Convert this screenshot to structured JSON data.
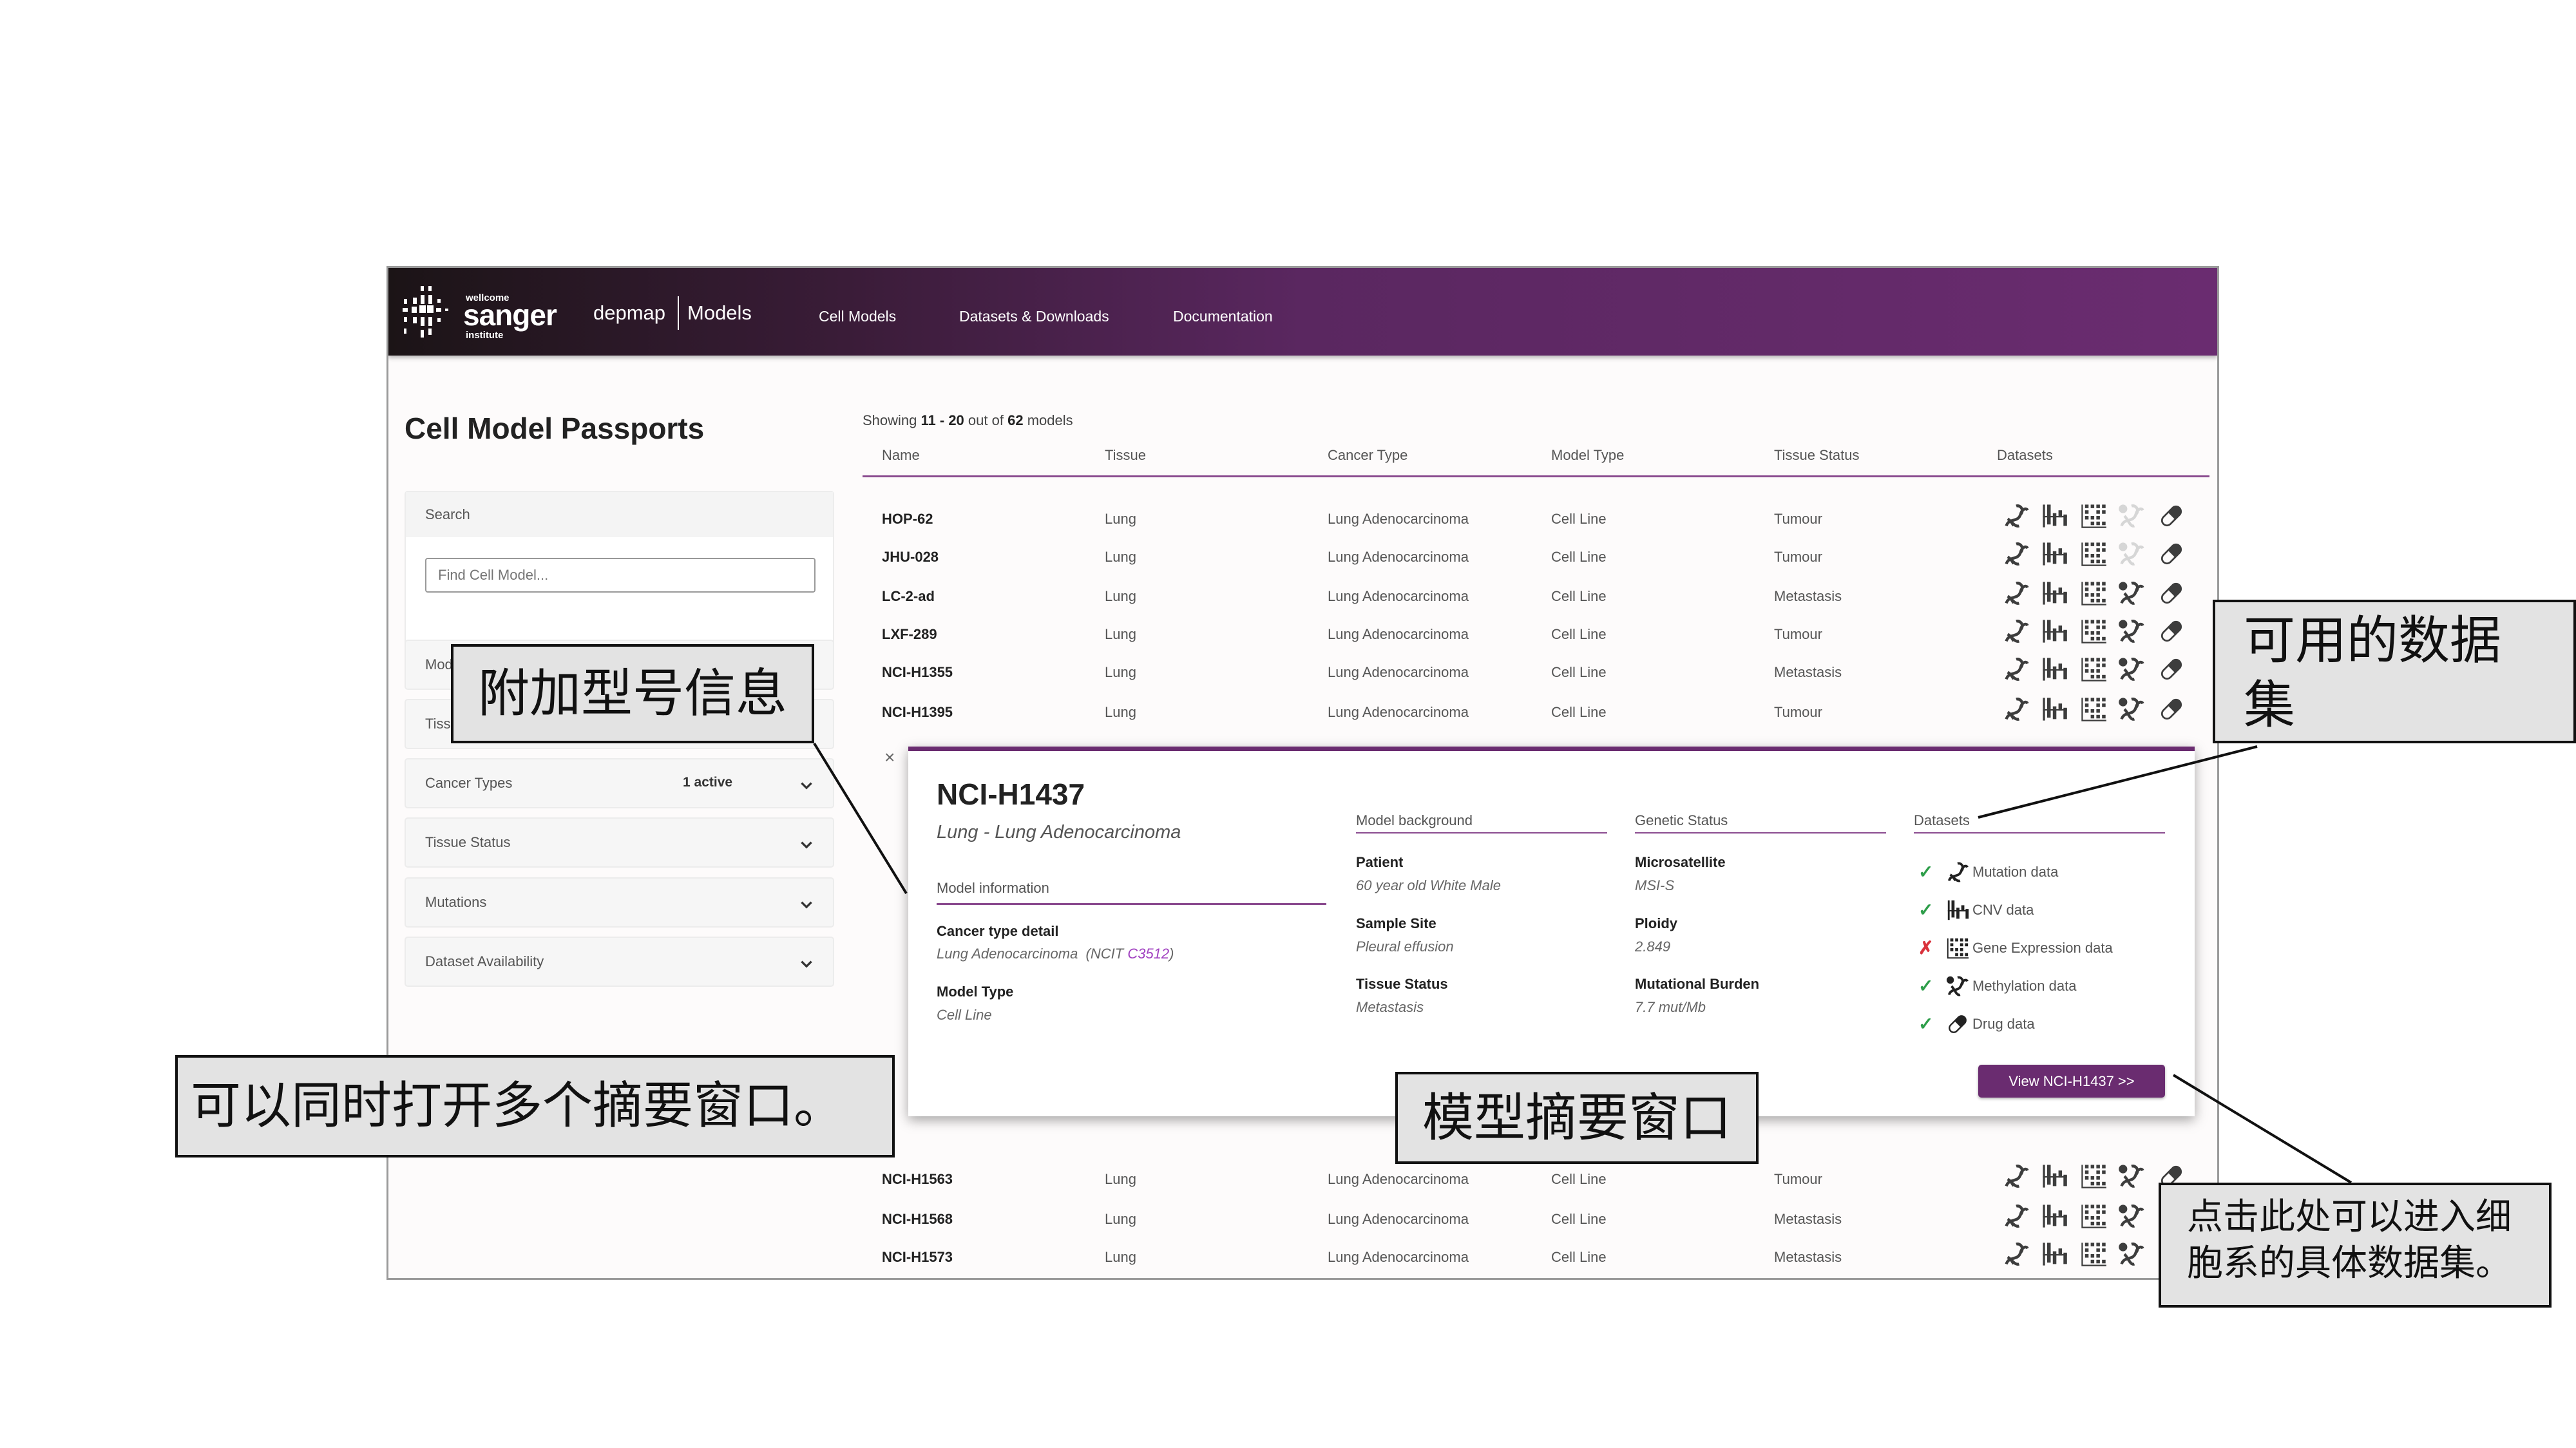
{
  "header": {
    "logo": {
      "top": "wellcome",
      "main": "sanger",
      "bottom": "institute"
    },
    "brand": "depmap",
    "section": "Models",
    "nav": [
      "Cell Models",
      "Datasets & Downloads",
      "Documentation"
    ]
  },
  "page_title": "Cell Model Passports",
  "showing": {
    "prefix": "Showing",
    "range": "11 - 20",
    "mid": "out of",
    "total": "62",
    "suffix": "models"
  },
  "table": {
    "columns": [
      "Name",
      "Tissue",
      "Cancer Type",
      "Model Type",
      "Tissue Status",
      "Datasets"
    ],
    "dataset_icons": [
      "mutation-icon",
      "cnv-icon",
      "gene-expression-icon",
      "methylation-icon",
      "drug-icon"
    ],
    "rows_top": [
      {
        "name": "HOP-62",
        "tissue": "Lung",
        "cancer_type": "Lung Adenocarcinoma",
        "model_type": "Cell Line",
        "tissue_status": "Tumour",
        "datasets": [
          true,
          true,
          true,
          false,
          true
        ]
      },
      {
        "name": "JHU-028",
        "tissue": "Lung",
        "cancer_type": "Lung Adenocarcinoma",
        "model_type": "Cell Line",
        "tissue_status": "Tumour",
        "datasets": [
          true,
          true,
          true,
          false,
          true
        ]
      },
      {
        "name": "LC-2-ad",
        "tissue": "Lung",
        "cancer_type": "Lung Adenocarcinoma",
        "model_type": "Cell Line",
        "tissue_status": "Metastasis",
        "datasets": [
          true,
          true,
          true,
          true,
          true
        ]
      },
      {
        "name": "LXF-289",
        "tissue": "Lung",
        "cancer_type": "Lung Adenocarcinoma",
        "model_type": "Cell Line",
        "tissue_status": "Tumour",
        "datasets": [
          true,
          true,
          true,
          true,
          true
        ]
      },
      {
        "name": "NCI-H1355",
        "tissue": "Lung",
        "cancer_type": "Lung Adenocarcinoma",
        "model_type": "Cell Line",
        "tissue_status": "Metastasis",
        "datasets": [
          true,
          true,
          true,
          true,
          true
        ]
      },
      {
        "name": "NCI-H1395",
        "tissue": "Lung",
        "cancer_type": "Lung Adenocarcinoma",
        "model_type": "Cell Line",
        "tissue_status": "Tumour",
        "datasets": [
          true,
          true,
          true,
          true,
          true
        ]
      }
    ],
    "rows_bottom": [
      {
        "name": "NCI-H1563",
        "tissue": "Lung",
        "cancer_type": "Lung Adenocarcinoma",
        "model_type": "Cell Line",
        "tissue_status": "Tumour",
        "datasets": [
          true,
          true,
          true,
          true,
          true
        ]
      },
      {
        "name": "NCI-H1568",
        "tissue": "Lung",
        "cancer_type": "Lung Adenocarcinoma",
        "model_type": "Cell Line",
        "tissue_status": "Metastasis",
        "datasets": [
          true,
          true,
          true,
          true,
          false
        ]
      },
      {
        "name": "NCI-H1573",
        "tissue": "Lung",
        "cancer_type": "Lung Adenocarcinoma",
        "model_type": "Cell Line",
        "tissue_status": "Metastasis",
        "datasets": [
          true,
          true,
          true,
          true,
          false
        ]
      }
    ]
  },
  "sidebar": {
    "search": {
      "label": "Search",
      "placeholder": "Find Cell Model..."
    },
    "filters": [
      {
        "label": "Model Types",
        "visible_label": "Mod",
        "active": ""
      },
      {
        "label": "Tissues",
        "visible_label": "Tiss",
        "active": ""
      },
      {
        "label": "Cancer Types",
        "visible_label": "Cancer Types",
        "active": "1 active"
      },
      {
        "label": "Tissue Status",
        "visible_label": "Tissue Status",
        "active": ""
      },
      {
        "label": "Mutations",
        "visible_label": "Mutations",
        "active": ""
      },
      {
        "label": "Dataset Availability",
        "visible_label": "Dataset Availability",
        "active": ""
      }
    ]
  },
  "popup": {
    "close": "×",
    "title": "NCI-H1437",
    "subtitle": "Lung - Lung Adenocarcinoma",
    "model_information": {
      "label": "Model information",
      "cancer_type_detail_key": "Cancer type detail",
      "cancer_type_detail_value": "Lung Adenocarcinoma  (NCIT ",
      "ncit_code": "C3512",
      "cancer_type_detail_close": ")",
      "model_type_key": "Model Type",
      "model_type_value": "Cell Line"
    },
    "model_background": {
      "label": "Model background",
      "items": [
        {
          "key": "Patient",
          "value": "60 year old White Male"
        },
        {
          "key": "Sample Site",
          "value": "Pleural effusion"
        },
        {
          "key": "Tissue Status",
          "value": "Metastasis"
        }
      ]
    },
    "genetic_status": {
      "label": "Genetic Status",
      "items": [
        {
          "key": "Microsatellite",
          "value": "MSI-S"
        },
        {
          "key": "Ploidy",
          "value": "2.849"
        },
        {
          "key": "Mutational Burden",
          "value": "7.7 mut/Mb"
        }
      ]
    },
    "datasets": {
      "label": "Datasets",
      "items": [
        {
          "label": "Mutation data",
          "available": true,
          "icon": "mutation-icon"
        },
        {
          "label": "CNV data",
          "available": true,
          "icon": "cnv-icon"
        },
        {
          "label": "Gene Expression data",
          "available": false,
          "icon": "gene-expression-icon"
        },
        {
          "label": "Methylation data",
          "available": true,
          "icon": "methylation-icon"
        },
        {
          "label": "Drug data",
          "available": true,
          "icon": "drug-icon"
        }
      ]
    },
    "view_button": "View NCI-H1437 >>"
  },
  "annotations": {
    "additional_info": "附加型号信息",
    "available_datasets_line1": "可用的数据",
    "available_datasets_line2": "集",
    "multiple_windows": "可以同时打开多个摘要窗口。",
    "summary_window": "模型摘要窗口",
    "click_here_line1": "点击此处可以进入细",
    "click_here_line2": "胞系的具体数据集。"
  },
  "colors": {
    "brand_purple": "#6a2c70",
    "check_green": "#2e9e4a",
    "cross_red": "#d9323c",
    "ncit_link": "#a040c0",
    "unavailable_icon": "#d6d6d6"
  }
}
